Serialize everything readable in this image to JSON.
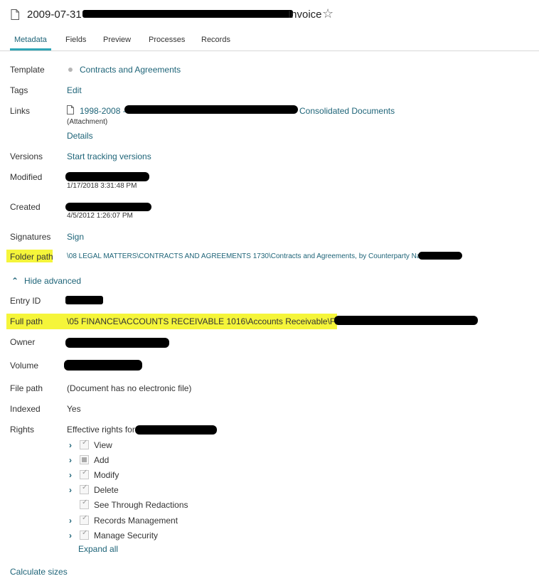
{
  "header": {
    "title_prefix": "2009-07-31 -",
    "title_suffix": "Invoice",
    "icons": {
      "document": "document-icon",
      "favorite": "star-outline-icon"
    }
  },
  "tabs": [
    {
      "label": "Metadata",
      "active": true
    },
    {
      "label": "Fields",
      "active": false
    },
    {
      "label": "Preview",
      "active": false
    },
    {
      "label": "Processes",
      "active": false
    },
    {
      "label": "Records",
      "active": false
    }
  ],
  "metadata": {
    "template": {
      "label": "Template",
      "value": "Contracts and Agreements"
    },
    "tags": {
      "label": "Tags",
      "action": "Edit"
    },
    "links": {
      "label": "Links",
      "link_prefix": "1998-2008 -",
      "link_suffix": "Consolidated Documents",
      "link_type": "(Attachment)",
      "details": "Details"
    },
    "versions": {
      "label": "Versions",
      "action": "Start tracking versions"
    },
    "modified": {
      "label": "Modified",
      "timestamp": "1/17/2018 3:31:48 PM"
    },
    "created": {
      "label": "Created",
      "timestamp": "4/5/2012 1:26:07 PM"
    },
    "signatures": {
      "label": "Signatures",
      "action": "Sign"
    },
    "folder_path": {
      "label": "Folder path",
      "value": "\\08 LEGAL MATTERS\\CONTRACTS AND AGREEMENTS 1730\\Contracts and Agreements, by Counterparty Name\\"
    }
  },
  "advanced": {
    "toggle_label": "Hide advanced",
    "entry_id": {
      "label": "Entry ID"
    },
    "full_path": {
      "label": "Full path",
      "value": "\\05 FINANCE\\ACCOUNTS RECEIVABLE 1016\\Accounts Receivable\\Finance"
    },
    "owner": {
      "label": "Owner"
    },
    "volume": {
      "label": "Volume"
    },
    "file_path": {
      "label": "File path",
      "value": "(Document has no electronic file)"
    },
    "indexed": {
      "label": "Indexed",
      "value": "Yes"
    },
    "rights": {
      "label": "Rights",
      "effective_prefix": "Effective rights for",
      "items": [
        {
          "label": "View",
          "expandable": true,
          "state": "checked"
        },
        {
          "label": "Add",
          "expandable": true,
          "state": "partial"
        },
        {
          "label": "Modify",
          "expandable": true,
          "state": "checked"
        },
        {
          "label": "Delete",
          "expandable": true,
          "state": "checked"
        },
        {
          "label": "See Through Redactions",
          "expandable": false,
          "state": "checked"
        },
        {
          "label": "Records Management",
          "expandable": true,
          "state": "checked"
        },
        {
          "label": "Manage Security",
          "expandable": true,
          "state": "checked"
        }
      ],
      "expand_all": "Expand all"
    }
  },
  "footer": {
    "calculate_sizes": "Calculate sizes"
  },
  "colors": {
    "link": "#1e6478",
    "tab_underline": "#2ea6b7",
    "highlight": "#f5f53a",
    "redaction": "#000000"
  }
}
